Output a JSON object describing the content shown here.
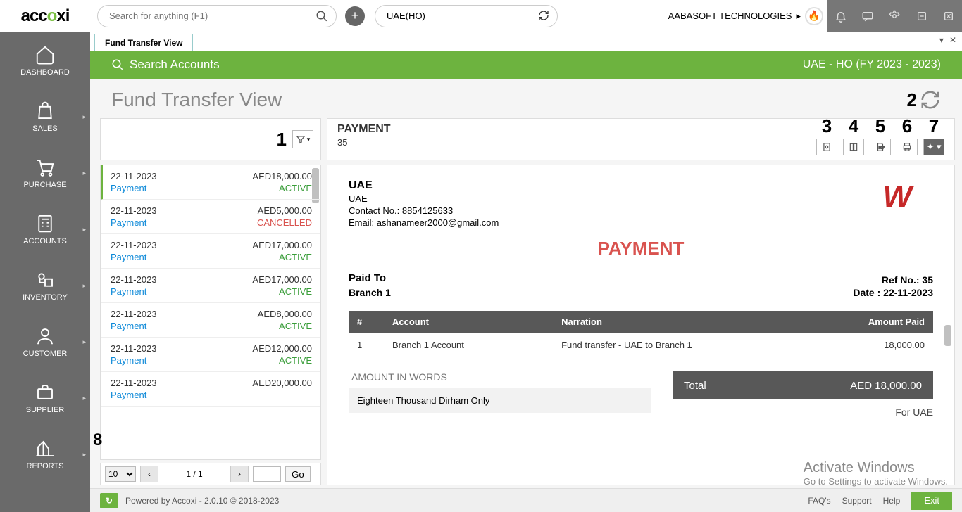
{
  "top": {
    "logo": "accoxi",
    "search_placeholder": "Search for anything (F1)",
    "branch": "UAE(HO)",
    "company": "AABASOFT TECHNOLOGIES"
  },
  "nav": {
    "items": [
      {
        "label": "DASHBOARD"
      },
      {
        "label": "SALES"
      },
      {
        "label": "PURCHASE"
      },
      {
        "label": "ACCOUNTS"
      },
      {
        "label": "INVENTORY"
      },
      {
        "label": "CUSTOMER"
      },
      {
        "label": "SUPPLIER"
      },
      {
        "label": "REPORTS"
      }
    ]
  },
  "tab": {
    "label": "Fund Transfer View"
  },
  "greenbar": {
    "search": "Search Accounts",
    "right": "UAE - HO (FY 2023 - 2023)"
  },
  "page_title": "Fund Transfer View",
  "list": {
    "items": [
      {
        "date": "22-11-2023",
        "amount": "AED18,000.00",
        "type": "Payment",
        "status": "ACTIVE",
        "cancel": false,
        "selected": true
      },
      {
        "date": "22-11-2023",
        "amount": "AED5,000.00",
        "type": "Payment",
        "status": "CANCELLED",
        "cancel": true
      },
      {
        "date": "22-11-2023",
        "amount": "AED17,000.00",
        "type": "Payment",
        "status": "ACTIVE",
        "cancel": false
      },
      {
        "date": "22-11-2023",
        "amount": "AED17,000.00",
        "type": "Payment",
        "status": "ACTIVE",
        "cancel": false
      },
      {
        "date": "22-11-2023",
        "amount": "AED8,000.00",
        "type": "Payment",
        "status": "ACTIVE",
        "cancel": false
      },
      {
        "date": "22-11-2023",
        "amount": "AED12,000.00",
        "type": "Payment",
        "status": "ACTIVE",
        "cancel": false
      },
      {
        "date": "22-11-2023",
        "amount": "AED20,000.00",
        "type": "Payment",
        "status": "",
        "cancel": false
      }
    ],
    "page_size": "10",
    "page_info": "1 / 1",
    "go": "Go"
  },
  "detail": {
    "head_title": "PAYMENT",
    "head_sub": "35",
    "company_name": "UAE",
    "company_loc": "UAE",
    "contact_lbl": "Contact No.: ",
    "contact": "8854125633",
    "email_lbl": "Email: ",
    "email": "ashanameer2000@gmail.com",
    "doc_title": "PAYMENT",
    "paid_to_lbl": "Paid To",
    "paid_to": "Branch 1",
    "ref_lbl": "Ref No.: ",
    "ref": "35",
    "date_lbl": "Date : ",
    "date": "22-11-2023",
    "cols": {
      "num": "#",
      "account": "Account",
      "narration": "Narration",
      "amount": "Amount Paid"
    },
    "rows": [
      {
        "num": "1",
        "account": "Branch 1 Account",
        "narration": "Fund transfer - UAE to Branch 1",
        "amount": "18,000.00"
      }
    ],
    "words_lbl": "AMOUNT IN WORDS",
    "words": "Eighteen Thousand Dirham Only",
    "total_lbl": "Total",
    "total": "AED 18,000.00",
    "for": "For UAE"
  },
  "footer": {
    "powered": "Powered by Accoxi - 2.0.10 © 2018-2023",
    "faq": "FAQ's",
    "support": "Support",
    "help": "Help",
    "exit": "Exit"
  },
  "watermark": {
    "l1": "Activate Windows",
    "l2": "Go to Settings to activate Windows."
  },
  "callouts": {
    "c1": "1",
    "c2": "2",
    "c3": "3",
    "c4": "4",
    "c5": "5",
    "c6": "6",
    "c7": "7",
    "c8": "8"
  }
}
